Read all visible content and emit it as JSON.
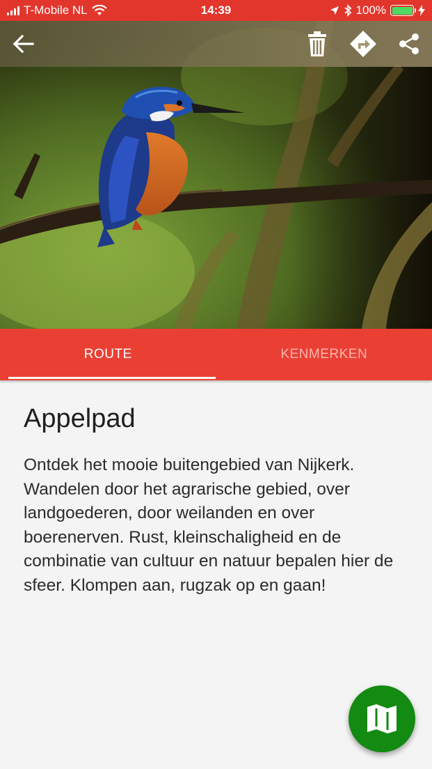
{
  "status_bar": {
    "carrier": "T-Mobile NL",
    "time": "14:39",
    "battery": "100%",
    "battery_level": 1.0,
    "battery_color": "#4cd964"
  },
  "toolbar": {
    "back_icon": "arrow-left-icon",
    "delete_icon": "trash-icon",
    "directions_icon": "directions-icon",
    "share_icon": "share-icon"
  },
  "hero": {
    "icon": "kingfisher-photo"
  },
  "tabs": [
    {
      "label": "ROUTE",
      "active": true
    },
    {
      "label": "KENMERKEN",
      "active": false
    }
  ],
  "main": {
    "title": "Appelpad",
    "description": "Ontdek het mooie buitengebied van Nijkerk. Wandelen door het agrarische gebied, over landgoederen, door weilanden en over boerenerven. Rust, kleinschaligheid en de combinatie van cultuur en natuur bepalen hier de sfeer. Klompen aan, rugzak op en gaan!"
  },
  "fab": {
    "icon": "map-icon",
    "color": "#138a12"
  },
  "colors": {
    "accent": "#ea4034",
    "status_bar": "#e2362c"
  }
}
